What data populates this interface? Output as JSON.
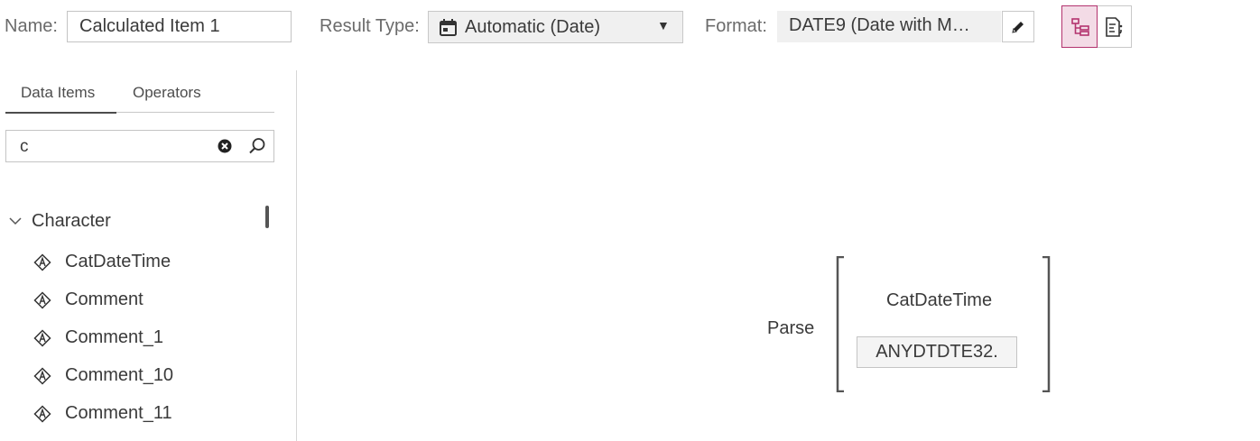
{
  "header": {
    "name_label": "Name:",
    "name_value": "Calculated Item 1",
    "result_type_label": "Result Type:",
    "result_type_value": "Automatic (Date)",
    "format_label": "Format:",
    "format_value": "DATE9 (Date with M…"
  },
  "icons": {
    "calendar": "calendar-icon",
    "dropdown": "chevron-down-icon",
    "edit": "pencil-icon",
    "tree_view": "tree-view-icon",
    "code_view": "code-view-icon",
    "clear": "clear-icon",
    "search": "search-icon",
    "character_item": "character-data-item-icon"
  },
  "left_panel": {
    "tabs": [
      {
        "label": "Data Items",
        "active": true
      },
      {
        "label": "Operators",
        "active": false
      }
    ],
    "search_value": "c",
    "groups": [
      {
        "label": "Character",
        "expanded": true,
        "items": [
          {
            "label": "CatDateTime"
          },
          {
            "label": "Comment"
          },
          {
            "label": "Comment_1"
          },
          {
            "label": "Comment_10"
          },
          {
            "label": "Comment_11"
          }
        ]
      }
    ]
  },
  "expression": {
    "operator": "Parse",
    "data_item": "CatDateTime",
    "informat": "ANYDTDTE32."
  },
  "colors": {
    "active_view_border": "#b3336e",
    "active_view_bg": "#f3dbe6"
  }
}
